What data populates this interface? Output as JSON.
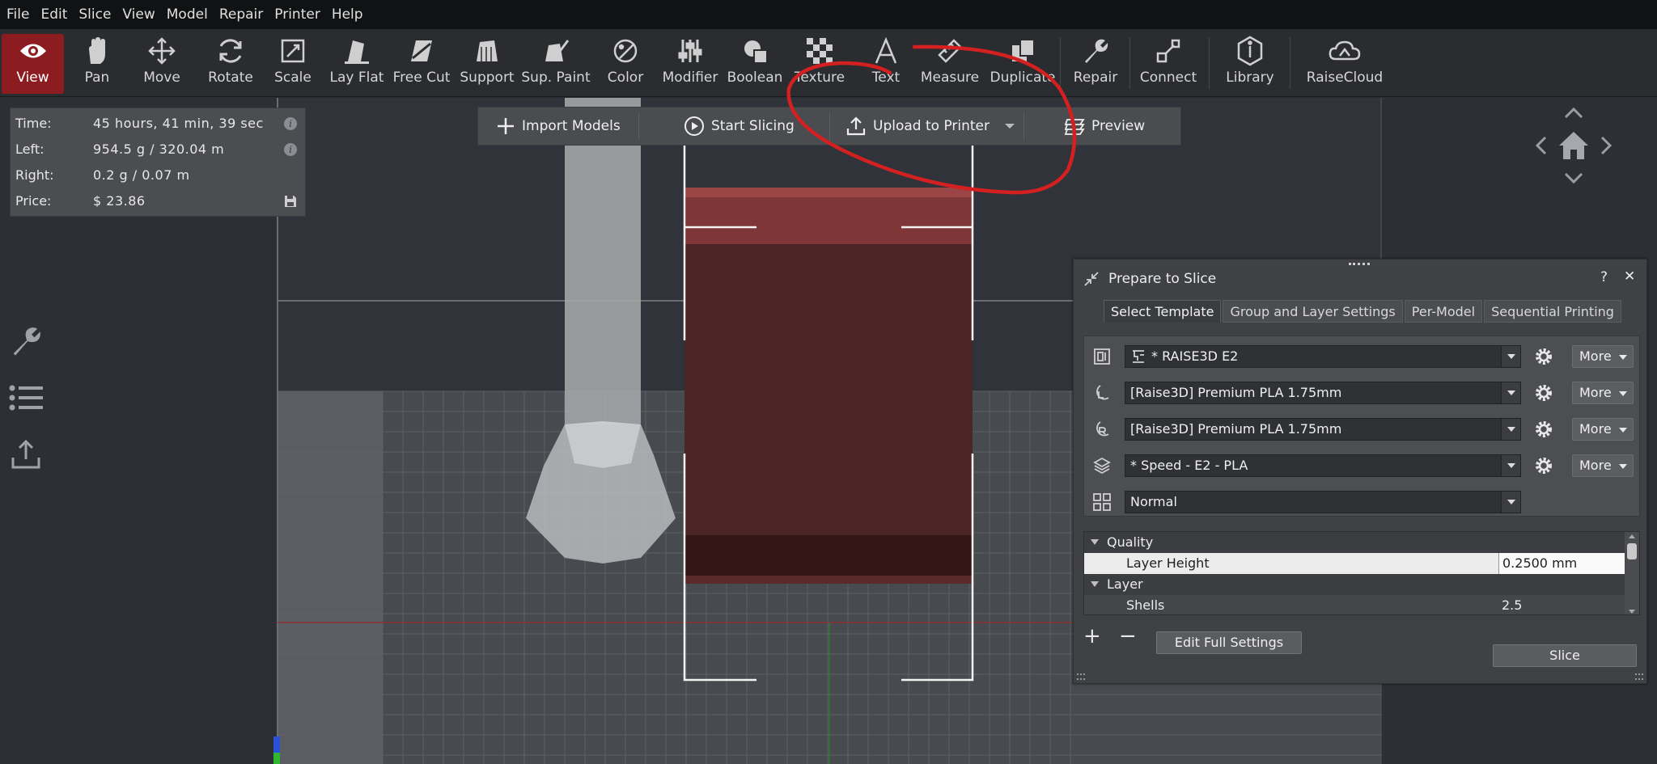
{
  "menu": [
    "File",
    "Edit",
    "Slice",
    "View",
    "Model",
    "Repair",
    "Printer",
    "Help"
  ],
  "toolbar": {
    "items": [
      {
        "label": "View",
        "icon": "eye-icon"
      },
      {
        "label": "Pan",
        "icon": "hand-icon"
      },
      {
        "label": "Move",
        "icon": "move-arrows-icon"
      },
      {
        "label": "Rotate",
        "icon": "rotate-icon"
      },
      {
        "label": "Scale",
        "icon": "scale-icon"
      },
      {
        "label": "Lay Flat",
        "icon": "lay-flat-icon"
      },
      {
        "label": "Free Cut",
        "icon": "free-cut-icon"
      },
      {
        "label": "Support",
        "icon": "support-icon"
      },
      {
        "label": "Sup. Paint",
        "icon": "support-paint-icon"
      },
      {
        "label": "Color",
        "icon": "color-icon"
      },
      {
        "label": "Modifier",
        "icon": "modifier-icon"
      },
      {
        "label": "Boolean",
        "icon": "boolean-icon"
      },
      {
        "label": "Texture",
        "icon": "texture-icon"
      },
      {
        "label": "Text",
        "icon": "text-icon"
      },
      {
        "label": "Measure",
        "icon": "measure-icon"
      },
      {
        "label": "Duplicate",
        "icon": "duplicate-icon"
      },
      {
        "label": "Repair",
        "icon": "wrench-icon"
      },
      {
        "label": "Connect",
        "icon": "connect-icon"
      },
      {
        "label": "Library",
        "icon": "library-icon"
      },
      {
        "label": "RaiseCloud",
        "icon": "cloud-icon"
      }
    ],
    "active": "View"
  },
  "info": {
    "time_label": "Time:",
    "time_value": "45 hours, 41 min, 39 sec",
    "left_label": "Left:",
    "left_value": "954.5 g / 320.04 m",
    "right_label": "Right:",
    "right_value": "0.2 g / 0.07 m",
    "price_label": "Price:",
    "price_value": "$ 23.86"
  },
  "actionbar": {
    "import": "Import Models",
    "start": "Start Slicing",
    "upload": "Upload to Printer",
    "preview": "Preview"
  },
  "prepare": {
    "title": "Prepare to Slice",
    "help": "?",
    "close": "✕",
    "tabs": [
      "Select Template",
      "Group and Layer Settings",
      "Per-Model",
      "Sequential Printing"
    ],
    "selected_tab": "Select Template",
    "printer": "* RAISE3D E2",
    "left_material": "[Raise3D] Premium PLA 1.75mm",
    "right_material": "[Raise3D] Premium PLA 1.75mm",
    "profile": "* Speed - E2 - PLA",
    "mode": "Normal",
    "more_label": "More",
    "settings": {
      "cat_quality": "Quality",
      "layer_height_label": "Layer Height",
      "layer_height_value": "0.2500 mm",
      "cat_layer": "Layer",
      "shells_label": "Shells",
      "shells_value": "2.5"
    },
    "add": "+",
    "remove": "−",
    "edit_full": "Edit Full Settings",
    "slice": "Slice"
  },
  "colors": {
    "accent": "#8c1c20",
    "model": "#4c2626",
    "annotation": "#d42020"
  }
}
